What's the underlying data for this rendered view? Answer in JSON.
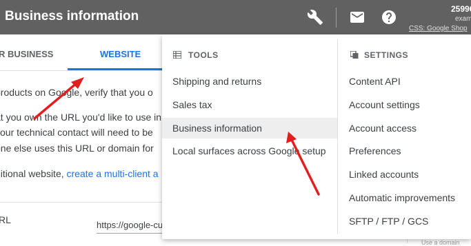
{
  "header": {
    "title": "Business information",
    "icons": [
      "wrench-icon",
      "mail-icon",
      "help-icon"
    ],
    "account_id": "25996",
    "account_email": "exam",
    "account_css": "CSS: Google Shop"
  },
  "tabs": [
    {
      "label": "R BUSINESS",
      "active": false
    },
    {
      "label": "WEBSITE",
      "active": true
    }
  ],
  "content": {
    "line1": "products on Google, verify that you o",
    "line2": "at you own the URL you'd like to use in",
    "line3": "your technical contact will need to be",
    "line4": "one else uses this URL or domain for",
    "line5_prefix": "ditional website, ",
    "line5_link": "create a multi-client a",
    "url_label": "RL",
    "url_value": "https://google-cu",
    "right_fragment": "Use a domain"
  },
  "menu": {
    "tools": {
      "heading": "TOOLS",
      "items": [
        {
          "label": "Shipping and returns"
        },
        {
          "label": "Sales tax"
        },
        {
          "label": "Business information",
          "selected": true
        },
        {
          "label": "Local surfaces across Google setup"
        }
      ]
    },
    "settings": {
      "heading": "SETTINGS",
      "items": [
        {
          "label": "Content API"
        },
        {
          "label": "Account settings"
        },
        {
          "label": "Account access"
        },
        {
          "label": "Preferences"
        },
        {
          "label": "Linked accounts"
        },
        {
          "label": "Automatic improvements"
        },
        {
          "label": "SFTP / FTP / GCS"
        }
      ]
    }
  },
  "colors": {
    "header_bg": "#616161",
    "accent": "#1a73e8",
    "annotation_arrow": "#e02020",
    "selected_item_bg": "#eeeeee"
  }
}
